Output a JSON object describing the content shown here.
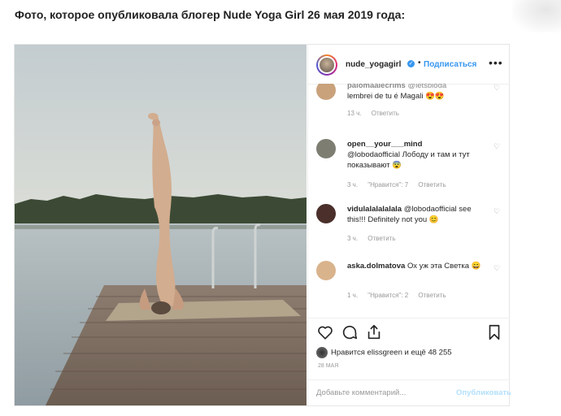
{
  "caption": "Фото, которое опубликовала блогер Nude Yoga Girl 26 мая 2019 года:",
  "post": {
    "username": "nude_yogagirl",
    "follow_label": "Подписаться",
    "more_label": "•••",
    "verified_mark": "✓",
    "dot": "•"
  },
  "comments": [
    {
      "user": "palomaalecrims",
      "mention": "@letsbloda",
      "text": "lembrei de tu é Magali 😍😍",
      "time": "13 ч.",
      "likes": "",
      "reply": "Ответить",
      "avatar_color": "#c9a27c"
    },
    {
      "user": "open__your___mind",
      "text": "@lobodaofficial Лободу и там и тут показывают 😨",
      "time": "3 ч.",
      "likes": "\"Нравится\": 7",
      "reply": "Ответить",
      "avatar_color": "#7d7d72"
    },
    {
      "user": "vidulalalalalala",
      "text": "@lobodaofficial see this!!! Definitely not you 😊",
      "time": "3 ч.",
      "likes": "",
      "reply": "Ответить",
      "avatar_color": "#4a2f2a"
    },
    {
      "user": "aska.dolmatova",
      "text": "Ох уж эта Светка 😄",
      "time": "1 ч.",
      "likes": "\"Нравится\": 2",
      "reply": "Ответить",
      "avatar_color": "#d9b38c"
    }
  ],
  "likes_text": "Нравится elissgreen и ещё 48 255",
  "date": "28 мая",
  "add_comment_placeholder": "Добавьте комментарий...",
  "publish_label": "Опубликовать",
  "icons": [
    "heart-icon",
    "comment-icon",
    "share-icon",
    "bookmark-icon",
    "comment-like-heart-icon"
  ],
  "colors": {
    "accent": "#3897f0",
    "publish_disabled": "#b2dffc",
    "meta_text": "#999999"
  }
}
